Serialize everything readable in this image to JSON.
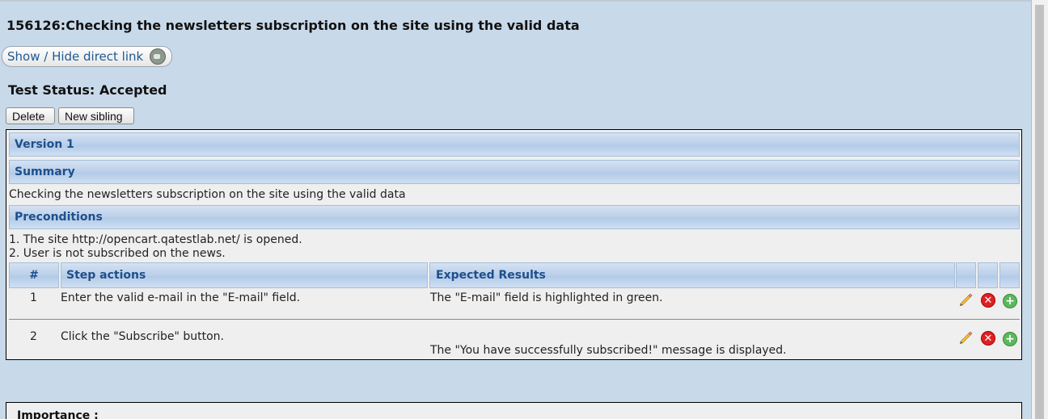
{
  "header": {
    "title": "156126:Checking the newsletters subscription on the site using the valid data",
    "direct_link_label": "Show / Hide direct link",
    "status": "Test Status: Accepted"
  },
  "buttons": {
    "delete": "Delete",
    "new_sibling": "New sibling"
  },
  "spec": {
    "version": "Version 1",
    "summary_title": "Summary",
    "summary_text": "Checking the newsletters subscription on the site using the valid data",
    "preconditions_title": "Preconditions",
    "preconditions": [
      "1. The site http://opencart.qatestlab.net/ is opened.",
      "2. User is not subscribed on the news."
    ],
    "columns": {
      "num": "#",
      "actions": "Step actions",
      "expected": "Expected Results"
    },
    "steps": [
      {
        "num": "1",
        "action": "Enter the valid e-mail in the \"E-mail\" field.",
        "expected": "The \"E-mail\" field is highlighted in green."
      },
      {
        "num": "2",
        "action": "Click the \"Subscribe\" button.",
        "expected": "The \"You have successfully subscribed!\" message is displayed."
      }
    ]
  },
  "importance_label": "Importance :",
  "icons": {
    "edit": "pencil-icon",
    "delete": "delete-icon",
    "add": "add-icon",
    "link": "link-icon"
  }
}
